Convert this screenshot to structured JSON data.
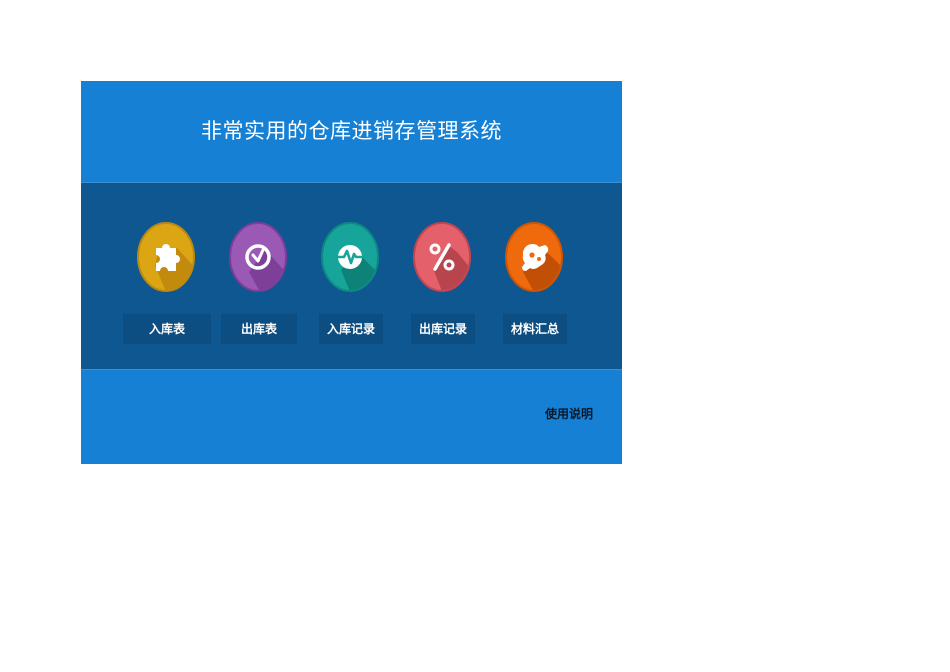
{
  "header": {
    "title": "非常实用的仓库进销存管理系统"
  },
  "tiles": [
    {
      "label": "入库表",
      "icon": "puzzle-icon",
      "color": "#dba513",
      "shade": "#c38b0d"
    },
    {
      "label": "出库表",
      "icon": "clock-icon",
      "color": "#9b59b6",
      "shade": "#7e3f98"
    },
    {
      "label": "入库记录",
      "icon": "pulse-icon",
      "color": "#17a49a",
      "shade": "#0e8178"
    },
    {
      "label": "出库记录",
      "icon": "percent-icon",
      "color": "#e4616b",
      "shade": "#b8444d"
    },
    {
      "label": "材料汇总",
      "icon": "tools-icon",
      "color": "#ee6a0c",
      "shade": "#c24f06"
    }
  ],
  "footer": {
    "help_label": "使用说明"
  },
  "colors": {
    "header_bg": "#1580d4",
    "middle_bg": "#0e5791",
    "label_bg": "#0c4d82"
  }
}
